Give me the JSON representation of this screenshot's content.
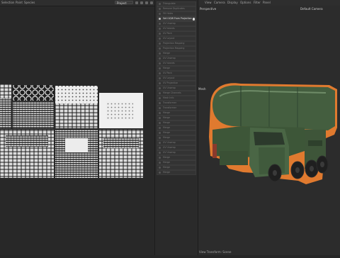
{
  "uv_editor": {
    "menu": [
      "Selection",
      "Paint",
      "Species"
    ],
    "project_select": "Project"
  },
  "operations_panel": {
    "items": [
      {
        "label": "Triangulate",
        "active": false
      },
      {
        "label": "Remove Duplicates",
        "active": false
      },
      {
        "label": "Fill Holes",
        "active": false
      },
      {
        "label": "Set UV/W From Projection",
        "active": true
      },
      {
        "label": "UV Unwrap",
        "active": false
      },
      {
        "label": "UV Islands",
        "active": false
      },
      {
        "label": "UV Pack",
        "active": false
      },
      {
        "label": "UV Layout",
        "active": false
      },
      {
        "label": "Projection Mapping",
        "active": false
      },
      {
        "label": "Projection Mapping",
        "active": false
      },
      {
        "label": "Merge",
        "active": false
      },
      {
        "label": "UV Unwrap",
        "active": false
      },
      {
        "label": "UV Islands",
        "active": false
      },
      {
        "label": "Merge",
        "active": false
      },
      {
        "label": "UV Pack",
        "active": false
      },
      {
        "label": "UV Layout",
        "active": false
      },
      {
        "label": "UV Projection",
        "active": false
      },
      {
        "label": "UV Unwrap",
        "active": false
      },
      {
        "label": "Merge Channels",
        "active": false
      },
      {
        "label": "Mesh Info",
        "active": false
      },
      {
        "label": "Transformer",
        "active": false
      },
      {
        "label": "Transformer",
        "active": false
      },
      {
        "label": "Merge",
        "active": false
      },
      {
        "label": "Merge",
        "active": false
      },
      {
        "label": "Merge",
        "active": false
      },
      {
        "label": "Merge",
        "active": false
      },
      {
        "label": "Merge",
        "active": false
      },
      {
        "label": "Merge",
        "active": false
      },
      {
        "label": "UV Unwrap",
        "active": false
      },
      {
        "label": "UV Unwrap",
        "active": false
      },
      {
        "label": "UV Unwrap",
        "active": false
      },
      {
        "label": "Merge",
        "active": false
      },
      {
        "label": "Merge",
        "active": false
      },
      {
        "label": "Merge",
        "active": false
      },
      {
        "label": "Merge",
        "active": false
      }
    ]
  },
  "viewport": {
    "menu": [
      "View",
      "Camera",
      "Display",
      "Options",
      "Filter",
      "Panel"
    ],
    "projection": "Perspective",
    "camera": "Default Camera",
    "object_label": "Mesh",
    "status": "View Transform: Scene"
  },
  "colors": {
    "selection_outline": "#e07a2f",
    "vehicle_green": "#3f5a3a"
  }
}
